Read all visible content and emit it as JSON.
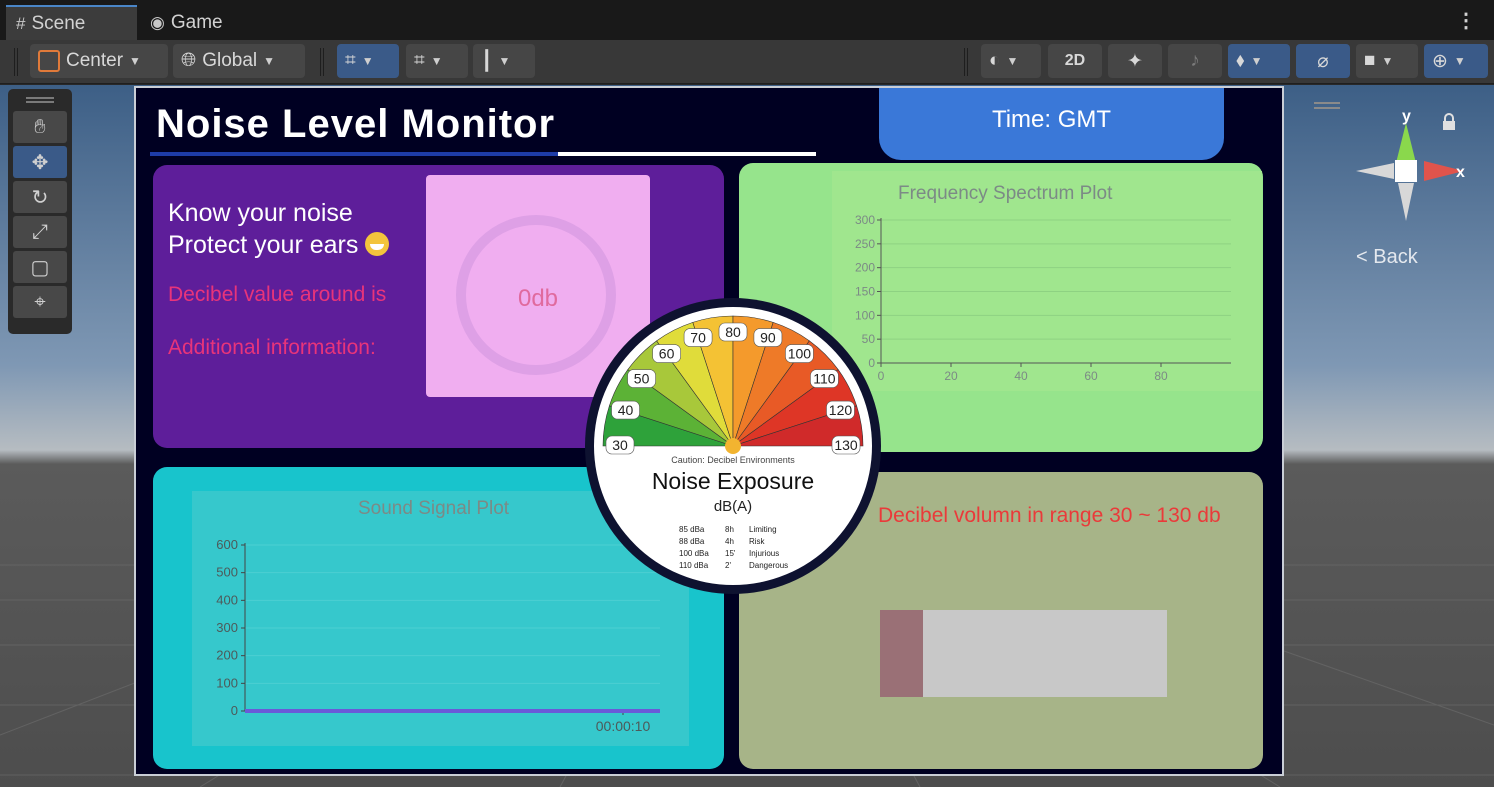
{
  "tabs": [
    {
      "label": "Scene",
      "icon": "grid-hash-icon"
    },
    {
      "label": "Game",
      "icon": "gamepad-icon"
    }
  ],
  "toolbar": {
    "pivot_label": "Center",
    "space_label": "Global",
    "mode_2d_label": "2D"
  },
  "gizmo": {
    "y_label": "y",
    "x_label": "x",
    "back_label": "< Back"
  },
  "canvas": {
    "title": "Noise Level Monitor",
    "time_label": "Time: GMT",
    "info": {
      "line1": "Know your noise",
      "line2": "Protect your ears",
      "decibel_label": "Decibel value around is",
      "additional_label": "Additional information:",
      "db_value": "0db"
    },
    "message": "Decibel volumn in range 30 ~ 130 db",
    "level_fraction": 0.15,
    "gauge": {
      "title": "Noise Exposure",
      "unit": "dB(A)",
      "caption": "Caution: Decibel Environments",
      "scale": [
        "30",
        "40",
        "50",
        "60",
        "70",
        "80",
        "90",
        "100",
        "110",
        "120",
        "130"
      ],
      "legend": [
        [
          "85 dBa",
          "8h",
          "Limiting"
        ],
        [
          "88 dBa",
          "4h",
          "Risk"
        ],
        [
          "100 dBa",
          "15'",
          "Injurious"
        ],
        [
          "110 dBa",
          "2'",
          "Dangerous"
        ]
      ]
    }
  },
  "chart_data": [
    {
      "type": "line",
      "title": "Frequency Spectrum Plot",
      "xlabel": "",
      "ylabel": "",
      "x_ticks": [
        0,
        20,
        40,
        60,
        80
      ],
      "y_ticks": [
        0,
        50,
        100,
        150,
        200,
        250,
        300
      ],
      "xlim": [
        0,
        100
      ],
      "ylim": [
        0,
        300
      ],
      "series": []
    },
    {
      "type": "line",
      "title": "Sound Signal Plot",
      "xlabel": "",
      "ylabel": "",
      "x_ticks": [
        "00:00:10"
      ],
      "y_ticks": [
        0,
        100,
        200,
        300,
        400,
        500,
        600
      ],
      "ylim": [
        0,
        600
      ],
      "series": [
        {
          "values": [
            0,
            0
          ]
        }
      ]
    }
  ]
}
